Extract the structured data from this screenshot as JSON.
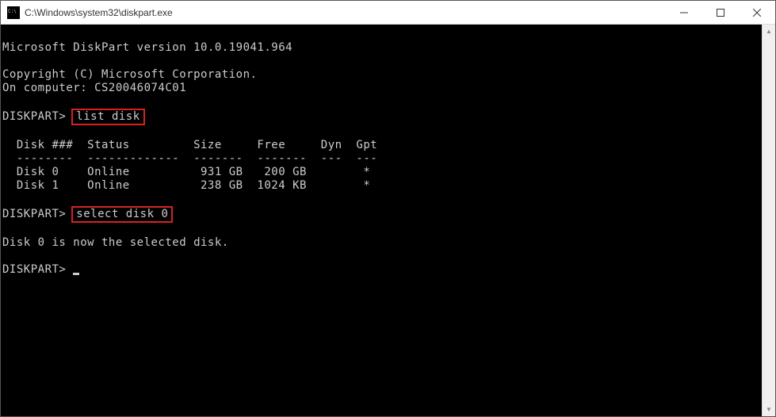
{
  "titlebar": {
    "title": "C:\\Windows\\system32\\diskpart.exe"
  },
  "terminal": {
    "version_line": "Microsoft DiskPart version 10.0.19041.964",
    "copyright_line": "Copyright (C) Microsoft Corporation.",
    "computer_line": "On computer: CS20046074C01",
    "prompt1": "DISKPART> ",
    "cmd1": "list disk",
    "table_header": "  Disk ###  Status         Size     Free     Dyn  Gpt",
    "table_divider": "  --------  -------------  -------  -------  ---  ---",
    "table_row1": "  Disk 0    Online          931 GB   200 GB        *",
    "table_row2": "  Disk 1    Online          238 GB  1024 KB        *",
    "prompt2": "DISKPART> ",
    "cmd2": "select disk 0",
    "result2": "Disk 0 is now the selected disk.",
    "prompt3": "DISKPART> "
  }
}
